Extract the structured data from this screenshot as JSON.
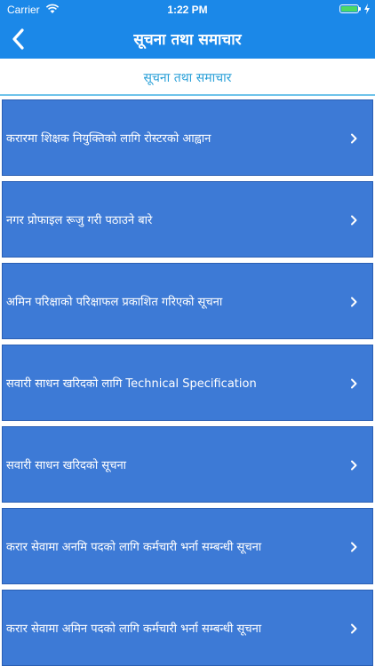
{
  "status_bar": {
    "carrier": "Carrier",
    "time": "1:22 PM",
    "battery_level": 1.0,
    "battery_color": "#4cd964",
    "icons": [
      "wifi-icon",
      "battery-icon",
      "charging-icon"
    ]
  },
  "nav": {
    "title": "सूचना तथा समाचार",
    "back_icon": "chevron-left-icon",
    "background_color": "#1b88e8"
  },
  "subheader": {
    "title": "सूचना तथा समाचार",
    "accent_color": "#29a0d8"
  },
  "notices": {
    "item_color": "#3d7ad6",
    "chevron_icon": "chevron-right-icon",
    "items": [
      {
        "label": "करारमा शिक्षक नियुक्तिको लागि रोस्टरको आह्वान"
      },
      {
        "label": "नगर प्रोफाइल रूजु गरी पठाउने बारे"
      },
      {
        "label": "अमिन परिक्षाको परिक्षाफल प्रकाशित गरिएको सूचना"
      },
      {
        "label": "सवारी साधन खरिदको लागि Technical Specification"
      },
      {
        "label": "सवारी साधन खरिदको सूचना"
      },
      {
        "label": "करार सेवामा अनमि पदको लागि कर्मचारी भर्ना सम्बन्धी सूचना"
      },
      {
        "label": "करार सेवामा अमिन पदको लागि कर्मचारी भर्ना सम्बन्धी सूचना"
      }
    ]
  }
}
